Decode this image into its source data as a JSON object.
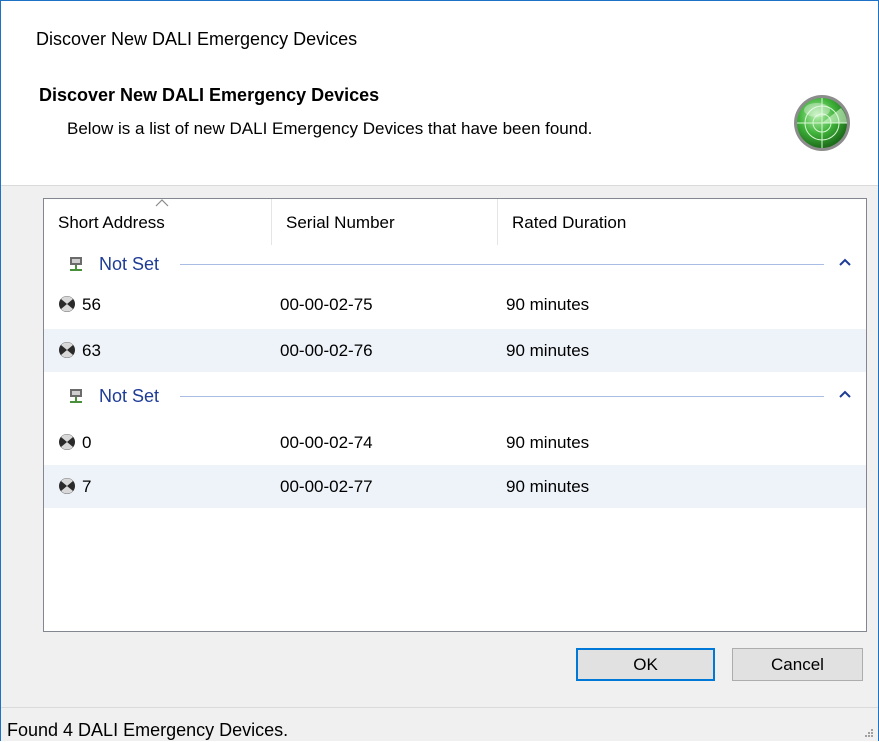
{
  "window": {
    "title": "Discover New DALI Emergency Devices"
  },
  "header": {
    "title": "Discover New DALI Emergency Devices",
    "description": "Below is a list of new DALI Emergency Devices that have been found.",
    "icon": "radar-icon"
  },
  "columns": [
    "Short Address",
    "Serial Number",
    "Rated Duration"
  ],
  "sort": {
    "column": "Short Address",
    "direction": "ascending"
  },
  "groups": [
    {
      "label": "Not Set",
      "expanded": true,
      "rows": [
        {
          "short_address": "56",
          "serial": "00-00-02-75",
          "duration": "90 minutes"
        },
        {
          "short_address": "63",
          "serial": "00-00-02-76",
          "duration": "90 minutes"
        }
      ]
    },
    {
      "label": "Not Set",
      "expanded": true,
      "rows": [
        {
          "short_address": "0",
          "serial": "00-00-02-74",
          "duration": "90 minutes"
        },
        {
          "short_address": "7",
          "serial": "00-00-02-77",
          "duration": "90 minutes"
        }
      ]
    }
  ],
  "buttons": {
    "ok": "OK",
    "cancel": "Cancel"
  },
  "status": {
    "text": "Found 4 DALI Emergency Devices."
  },
  "colors": {
    "accent": "#0078d7",
    "group_text": "#1e3c96",
    "alt_row": "#eef3fa"
  }
}
